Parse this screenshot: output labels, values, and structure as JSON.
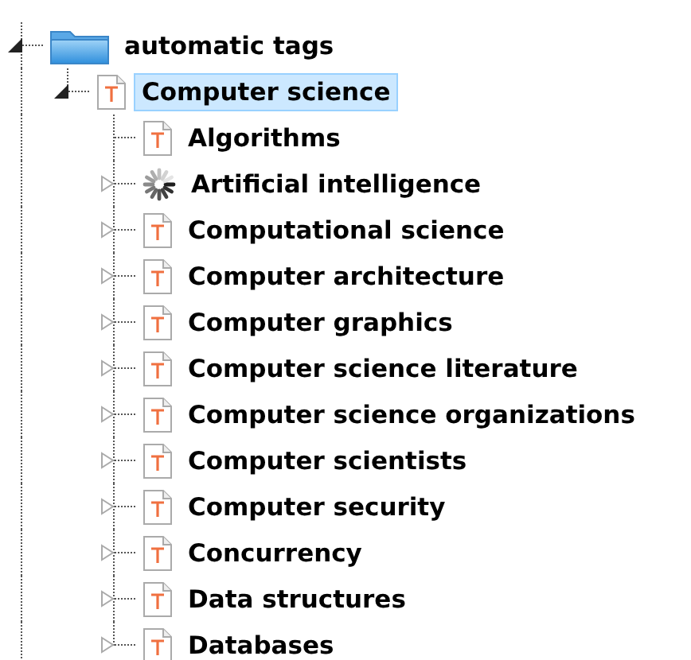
{
  "tree": [
    {
      "label": "automatic tags",
      "kind": "folder",
      "expandable": true,
      "expanded": true,
      "selected": false,
      "children": [
        {
          "label": "Computer science",
          "kind": "tag",
          "expandable": true,
          "expanded": true,
          "selected": true,
          "children": [
            {
              "label": "Algorithms",
              "kind": "tag",
              "expandable": false,
              "expanded": false,
              "selected": false
            },
            {
              "label": "Artificial intelligence",
              "kind": "loading",
              "expandable": true,
              "expanded": false,
              "selected": false
            },
            {
              "label": "Computational science",
              "kind": "tag",
              "expandable": true,
              "expanded": false,
              "selected": false
            },
            {
              "label": "Computer architecture",
              "kind": "tag",
              "expandable": true,
              "expanded": false,
              "selected": false
            },
            {
              "label": "Computer graphics",
              "kind": "tag",
              "expandable": true,
              "expanded": false,
              "selected": false
            },
            {
              "label": "Computer science literature",
              "kind": "tag",
              "expandable": true,
              "expanded": false,
              "selected": false
            },
            {
              "label": "Computer science organizations",
              "kind": "tag",
              "expandable": true,
              "expanded": false,
              "selected": false
            },
            {
              "label": "Computer scientists",
              "kind": "tag",
              "expandable": true,
              "expanded": false,
              "selected": false
            },
            {
              "label": "Computer security",
              "kind": "tag",
              "expandable": true,
              "expanded": false,
              "selected": false
            },
            {
              "label": "Concurrency",
              "kind": "tag",
              "expandable": true,
              "expanded": false,
              "selected": false
            },
            {
              "label": "Data structures",
              "kind": "tag",
              "expandable": true,
              "expanded": false,
              "selected": false
            },
            {
              "label": "Databases",
              "kind": "tag",
              "expandable": true,
              "expanded": false,
              "selected": false
            }
          ]
        }
      ]
    }
  ]
}
